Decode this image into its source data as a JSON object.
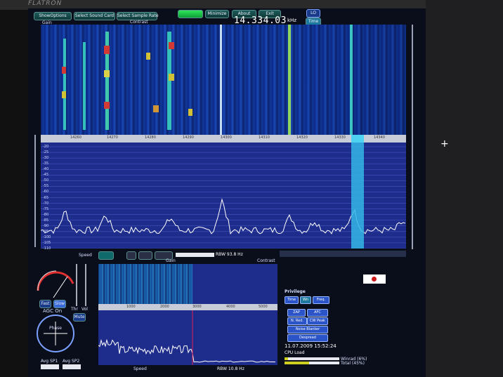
{
  "window": {
    "brand": "FLATRON"
  },
  "toolbar": {
    "show_options": "ShowOptions",
    "select_sound_card": "Select Sound Card",
    "select_sample_rate": "Select Sample Rate",
    "minimize": "Minimize",
    "about": "About",
    "exit": "Exit",
    "lo": "LO",
    "time": "Time"
  },
  "labels": {
    "gain": "Gain",
    "contrast": "Contrast",
    "khz": "kHz",
    "speed": "Speed",
    "rbw_main": "RBW 93.8 Hz",
    "rbw_small": "RBW 10.8 Hz",
    "gain2": "Gain",
    "contrast2": "Contrast"
  },
  "frequency": "14.334.03",
  "freq_scale": [
    "14260",
    "14270",
    "14280",
    "14290",
    "14300",
    "14310",
    "14320",
    "14330",
    "14340"
  ],
  "db_scale": [
    "-20",
    "-25",
    "-30",
    "-35",
    "-40",
    "-45",
    "-50",
    "-55",
    "-60",
    "-65",
    "-70",
    "-75",
    "-80",
    "-85",
    "-90",
    "-95",
    "-100",
    "-105",
    "-110"
  ],
  "small_scale": [
    "1000",
    "2000",
    "3000",
    "4000",
    "5000"
  ],
  "left_panel": {
    "fast": "Fast",
    "slow": "Slow",
    "agc": "AGC On",
    "thr": "Thr",
    "vol": "Vol",
    "mute": "Mute",
    "phase": "Phase",
    "avg1": "Avg SP1",
    "avg2": "Avg SP2"
  },
  "right_panel": {
    "privilege": "Privilege",
    "time": "Time",
    "fmt": "Wn",
    "freq": "Freq.",
    "zap": "ZAP",
    "afc": "AFC",
    "nred": "N. Red.",
    "cwpeak": "CW Peak",
    "nblanker": "Noise Blanker",
    "despread": "Despread",
    "datetime": "11.07.2009 15:52:24",
    "cpu": "CPU Load",
    "winrad": "Winrad (6%)",
    "total": "Total (45%)"
  }
}
